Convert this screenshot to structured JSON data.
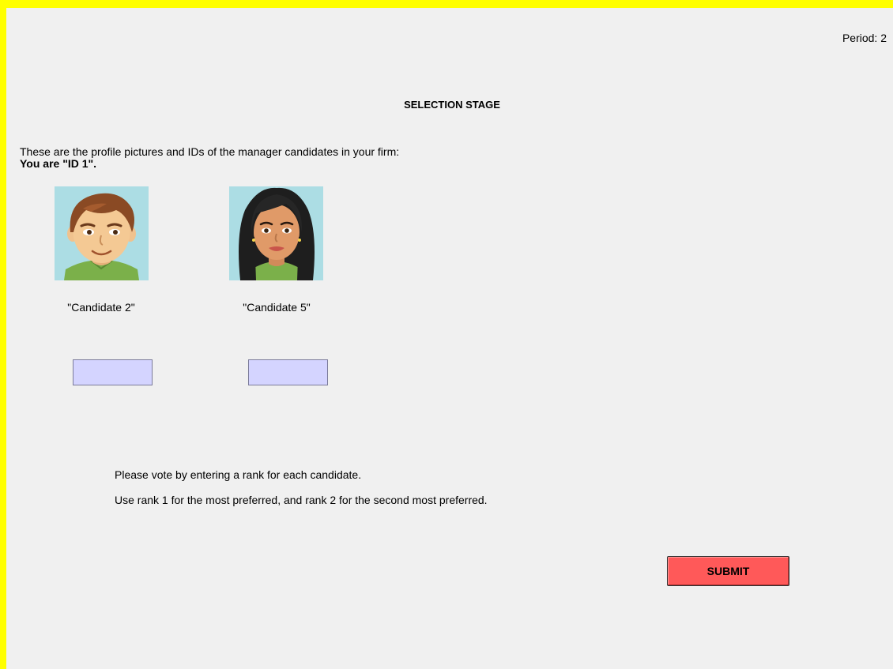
{
  "header": {
    "period": "Period: 2",
    "title": "SELECTION STAGE"
  },
  "intro": {
    "text": "These are the profile pictures and IDs of the manager candidates in your firm:",
    "you_are": "You are \"ID 1\"."
  },
  "candidates": [
    {
      "label": "\"Candidate 2\"",
      "rank_value": ""
    },
    {
      "label": "\"Candidate 5\"",
      "rank_value": ""
    }
  ],
  "instructions": {
    "line1": "Please vote by entering a rank for each candidate.",
    "line2": "Use rank 1 for the most preferred, and rank 2 for the second most preferred."
  },
  "submit_label": "SUBMIT",
  "colors": {
    "frame": "#ffff00",
    "background": "#f0f0f0",
    "input": "#d4d4ff",
    "submit": "#ff5959",
    "portrait_bg": "#acdde4",
    "shirt": "#7bb04a"
  },
  "icons": [
    "male-avatar-icon",
    "female-avatar-icon"
  ]
}
